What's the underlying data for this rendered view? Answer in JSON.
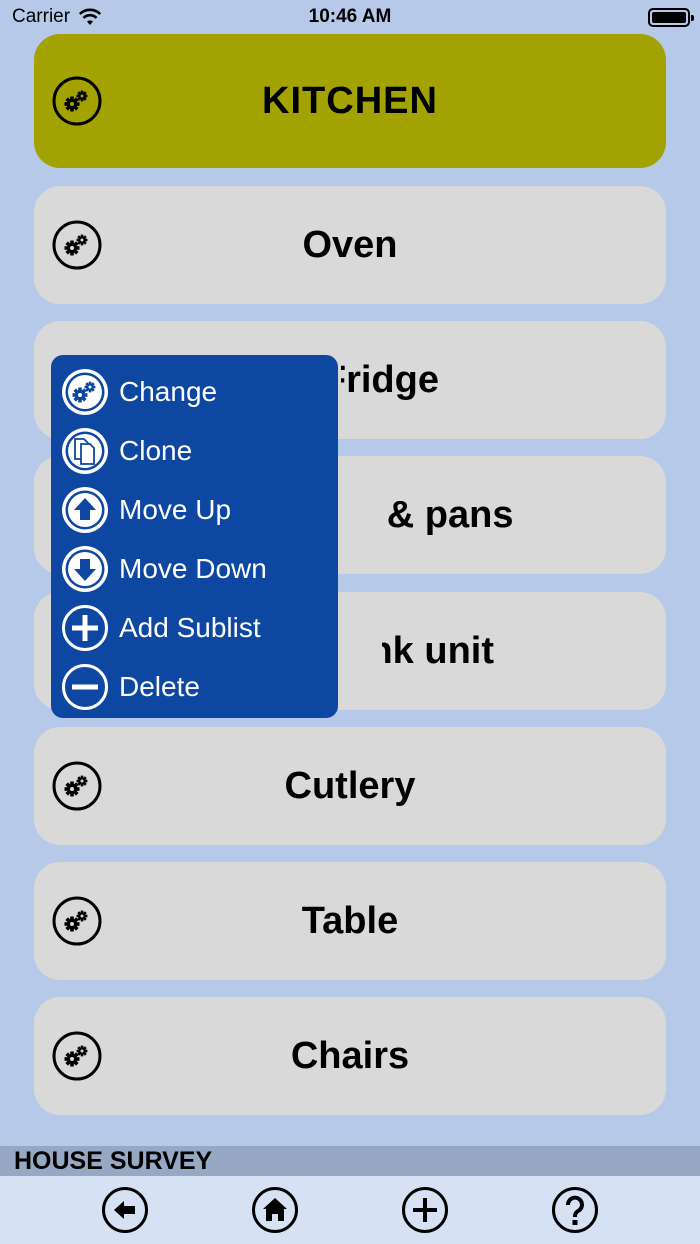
{
  "status_bar": {
    "carrier": "Carrier",
    "time": "10:46 AM"
  },
  "header": {
    "title": "KITCHEN"
  },
  "list": {
    "items": [
      {
        "label": "Oven"
      },
      {
        "label": "Fridge"
      },
      {
        "label": "Pots & pans"
      },
      {
        "label": "Sink unit"
      },
      {
        "label": "Cutlery"
      },
      {
        "label": "Table"
      },
      {
        "label": "Chairs"
      }
    ]
  },
  "popup_menu": {
    "items": [
      {
        "label": "Change",
        "icon": "gears-icon"
      },
      {
        "label": "Clone",
        "icon": "clone-icon"
      },
      {
        "label": "Move Up",
        "icon": "move-up-icon"
      },
      {
        "label": "Move Down",
        "icon": "move-down-icon"
      },
      {
        "label": "Add Sublist",
        "icon": "plus-icon"
      },
      {
        "label": "Delete",
        "icon": "minus-icon"
      }
    ]
  },
  "footer": {
    "section_title": "HOUSE SURVEY",
    "toolbar": [
      "back-icon",
      "home-icon",
      "add-icon",
      "help-icon"
    ]
  },
  "colors": {
    "background": "#b6c9e8",
    "header_row": "#a2a200",
    "row": "#d9d9d9",
    "popup": "#0d47a1",
    "footer_bar": "#97a8c4",
    "toolbar": "#d6e1f3"
  }
}
